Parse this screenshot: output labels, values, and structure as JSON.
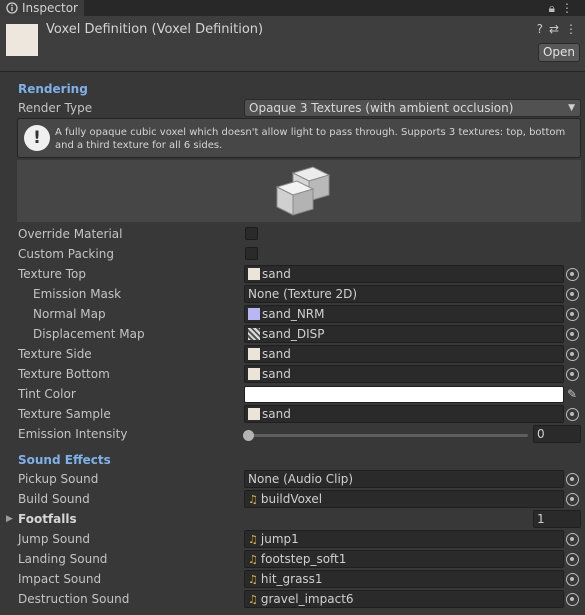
{
  "tab": {
    "label": "Inspector",
    "icon": "info-icon"
  },
  "window_tools": {
    "lock": "lock-icon",
    "menu": "kebab-menu-icon"
  },
  "header": {
    "title": "Voxel Definition (Voxel Definition)",
    "open_label": "Open",
    "icons": [
      "help-icon",
      "preset-icon",
      "more-icon"
    ]
  },
  "rendering": {
    "section_title": "Rendering",
    "render_type_label": "Render Type",
    "render_type_value": "Opaque 3 Textures (with ambient occlusion)",
    "help_text": "A fully opaque cubic voxel which doesn't allow light to pass through. Supports 3 textures: top, bottom and a third texture for all 6 sides.",
    "override_material_label": "Override Material",
    "override_material_checked": false,
    "custom_packing_label": "Custom Packing",
    "custom_packing_checked": false,
    "texture_top_label": "Texture Top",
    "texture_top_value": "sand",
    "emission_mask_label": "Emission Mask",
    "emission_mask_value": "None (Texture 2D)",
    "normal_map_label": "Normal Map",
    "normal_map_value": "sand_NRM",
    "displacement_map_label": "Displacement Map",
    "displacement_map_value": "sand_DISP",
    "texture_side_label": "Texture Side",
    "texture_side_value": "sand",
    "texture_bottom_label": "Texture Bottom",
    "texture_bottom_value": "sand",
    "tint_color_label": "Tint Color",
    "tint_color_value": "#FFFFFF",
    "texture_sample_label": "Texture Sample",
    "texture_sample_value": "sand",
    "emission_intensity_label": "Emission Intensity",
    "emission_intensity_value": "0"
  },
  "sound": {
    "section_title": "Sound Effects",
    "pickup_label": "Pickup Sound",
    "pickup_value": "None (Audio Clip)",
    "build_label": "Build Sound",
    "build_value": "buildVoxel",
    "footfalls_label": "Footfalls",
    "footfalls_value": "1",
    "jump_label": "Jump Sound",
    "jump_value": "jump1",
    "landing_label": "Landing Sound",
    "landing_value": "footstep_soft1",
    "impact_label": "Impact Sound",
    "impact_value": "hit_grass1",
    "destruction_label": "Destruction Sound",
    "destruction_value": "gravel_impact6"
  },
  "colors": {
    "background": "#383838",
    "section_title": "#7fb0e8",
    "field": "#2a2a2a",
    "audio_icon": "#e1b647"
  }
}
